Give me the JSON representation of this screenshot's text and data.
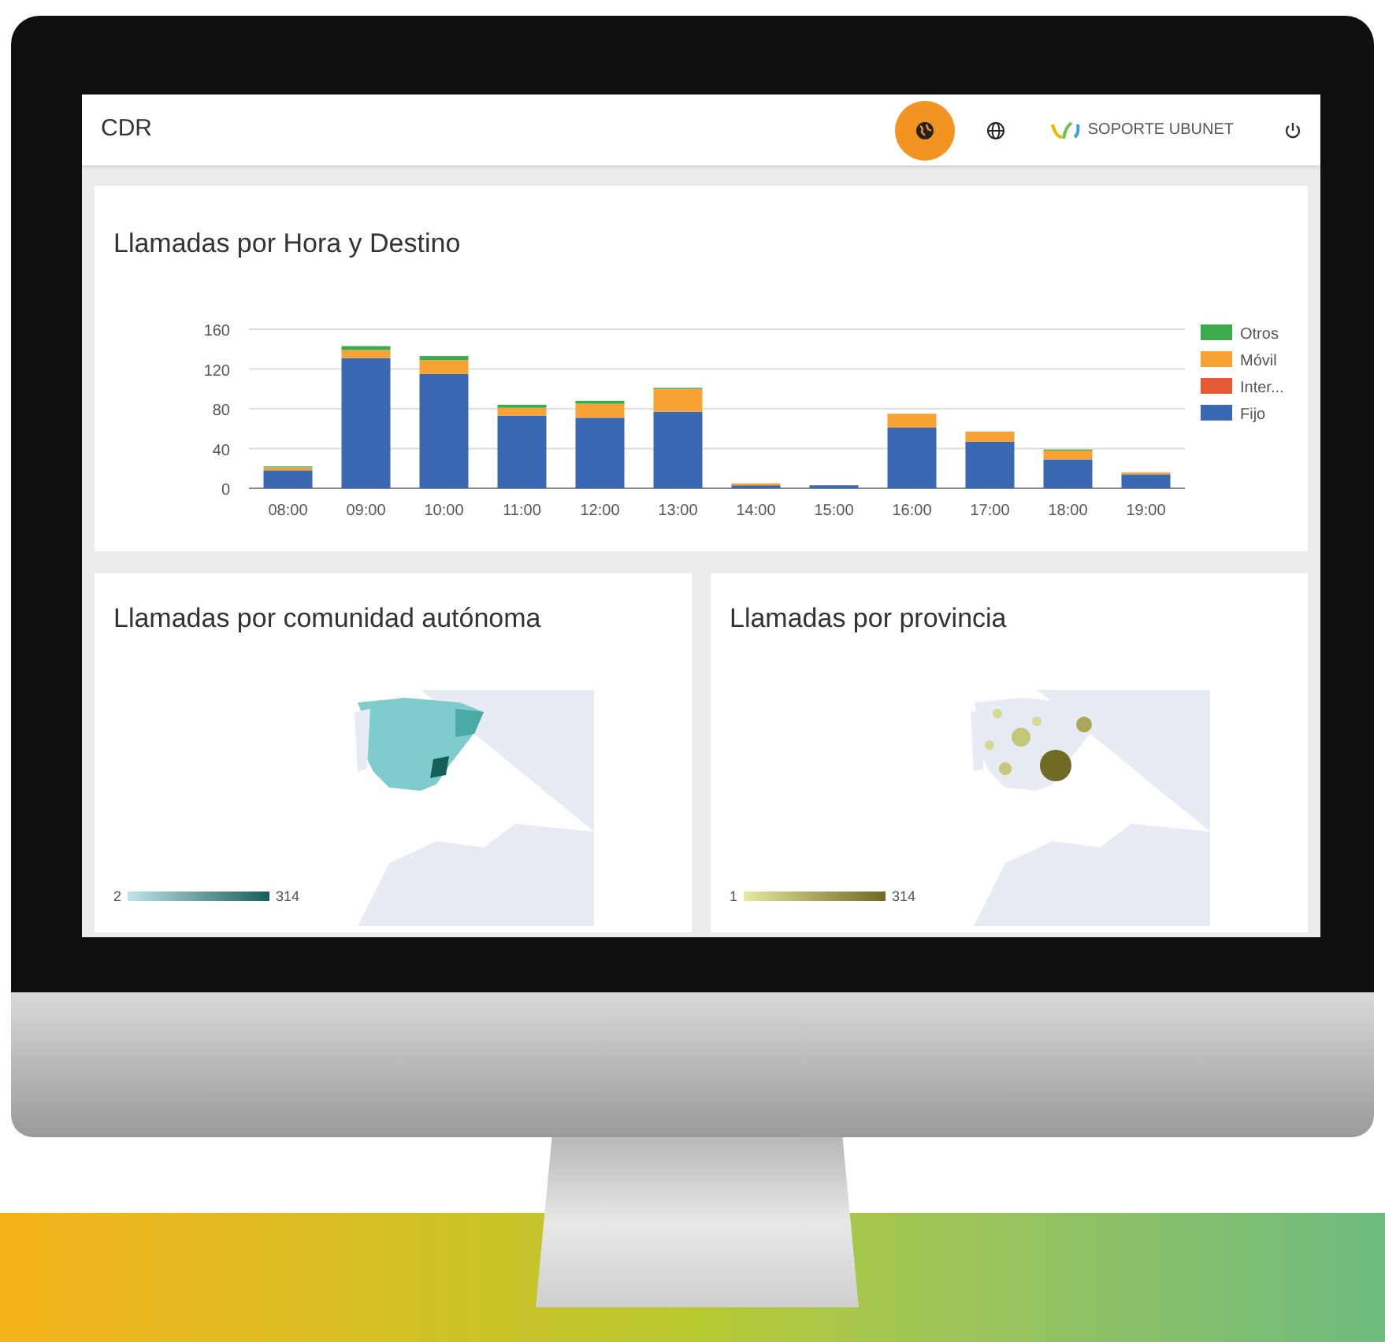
{
  "header": {
    "title": "CDR",
    "brand": "SOPORTE UBUNET"
  },
  "hour_chart": {
    "title": "Llamadas por Hora y Destino",
    "chart_data": {
      "type": "bar",
      "stacked": true,
      "categories": [
        "08:00",
        "09:00",
        "10:00",
        "11:00",
        "12:00",
        "13:00",
        "14:00",
        "15:00",
        "16:00",
        "17:00",
        "18:00",
        "19:00"
      ],
      "ylim": [
        0,
        160
      ],
      "grid": true,
      "legend": true,
      "yticks": [
        0,
        40,
        80,
        120,
        160
      ],
      "series": [
        {
          "name": "Fijo",
          "color": "#3b68b3",
          "values": [
            18,
            131,
            115,
            73,
            71,
            77,
            3,
            3,
            61,
            47,
            29,
            14
          ]
        },
        {
          "name": "Inter...",
          "color": "#e45a35",
          "values": [
            0,
            0,
            0,
            0,
            0,
            0,
            0,
            0,
            0,
            0,
            0,
            0
          ]
        },
        {
          "name": "Móvil",
          "color": "#f7a233",
          "values": [
            3,
            8,
            14,
            8,
            14,
            23,
            2,
            0,
            14,
            10,
            9,
            2
          ]
        },
        {
          "name": "Otros",
          "color": "#3bab4b",
          "values": [
            1,
            4,
            4,
            3,
            3,
            1,
            0,
            0,
            0,
            0,
            1,
            0
          ]
        }
      ]
    }
  },
  "region_map": {
    "title": "Llamadas por comunidad autónoma",
    "scale_min": "2",
    "scale_max": "314"
  },
  "province_map": {
    "title": "Llamadas por provincia",
    "scale_min": "1",
    "scale_max": "314"
  }
}
